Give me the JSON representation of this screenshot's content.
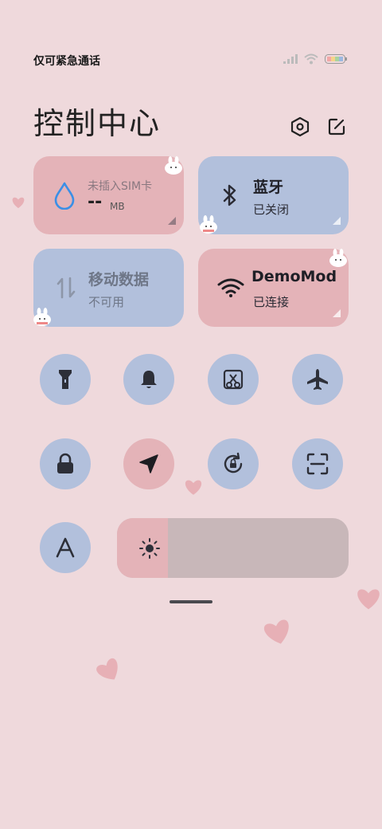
{
  "status_bar": {
    "carrier_text": "仅可紧急通话",
    "icons": [
      "signal-icon",
      "wifi-icon",
      "battery-icon"
    ],
    "battery_colors": [
      "#f2a7a7",
      "#f5d48a",
      "#a9d3a0",
      "#9cb8e0"
    ]
  },
  "header": {
    "title": "控制中心",
    "settings_icon": "settings-hexagon-icon",
    "edit_icon": "edit-icon"
  },
  "tiles": {
    "data_usage": {
      "line1": "未插入SIM卡",
      "value": "--",
      "unit": "MB",
      "icon": "water-drop-icon"
    },
    "bluetooth": {
      "label": "蓝牙",
      "status": "已关闭",
      "icon": "bluetooth-icon"
    },
    "mobile_data": {
      "label": "移动数据",
      "status": "不可用",
      "icon": "data-arrows-icon"
    },
    "wifi": {
      "label": "DemoMod",
      "status": "已连接",
      "icon": "wifi-icon"
    }
  },
  "toggles": [
    {
      "id": "flashlight",
      "icon": "flashlight-icon",
      "active": false
    },
    {
      "id": "ring",
      "icon": "bell-icon",
      "active": false
    },
    {
      "id": "screenshot",
      "icon": "screenshot-scissors-icon",
      "active": false
    },
    {
      "id": "airplane",
      "icon": "airplane-icon",
      "active": false
    },
    {
      "id": "lock",
      "icon": "lock-icon",
      "active": false
    },
    {
      "id": "location",
      "icon": "location-arrow-icon",
      "active": true
    },
    {
      "id": "rotation",
      "icon": "rotation-lock-icon",
      "active": false
    },
    {
      "id": "scanner",
      "icon": "scan-icon",
      "active": false
    },
    {
      "id": "font",
      "icon": "font-a-icon",
      "active": false
    }
  ],
  "brightness": {
    "level_fraction": 0.22,
    "icon": "sun-icon"
  },
  "colors": {
    "background": "#efd9dc",
    "pink_tile": "#e4b3b8",
    "blue_tile": "#b2c0dc",
    "accent_blue": "#3b8fe6"
  }
}
